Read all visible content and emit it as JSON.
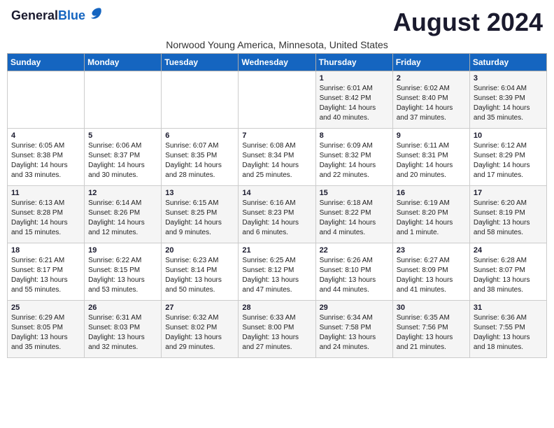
{
  "header": {
    "logo_general": "General",
    "logo_blue": "Blue",
    "month_title": "August 2024",
    "subtitle": "Norwood Young America, Minnesota, United States"
  },
  "days_of_week": [
    "Sunday",
    "Monday",
    "Tuesday",
    "Wednesday",
    "Thursday",
    "Friday",
    "Saturday"
  ],
  "weeks": [
    [
      {
        "day": "",
        "content": ""
      },
      {
        "day": "",
        "content": ""
      },
      {
        "day": "",
        "content": ""
      },
      {
        "day": "",
        "content": ""
      },
      {
        "day": "1",
        "content": "Sunrise: 6:01 AM\nSunset: 8:42 PM\nDaylight: 14 hours\nand 40 minutes."
      },
      {
        "day": "2",
        "content": "Sunrise: 6:02 AM\nSunset: 8:40 PM\nDaylight: 14 hours\nand 37 minutes."
      },
      {
        "day": "3",
        "content": "Sunrise: 6:04 AM\nSunset: 8:39 PM\nDaylight: 14 hours\nand 35 minutes."
      }
    ],
    [
      {
        "day": "4",
        "content": "Sunrise: 6:05 AM\nSunset: 8:38 PM\nDaylight: 14 hours\nand 33 minutes."
      },
      {
        "day": "5",
        "content": "Sunrise: 6:06 AM\nSunset: 8:37 PM\nDaylight: 14 hours\nand 30 minutes."
      },
      {
        "day": "6",
        "content": "Sunrise: 6:07 AM\nSunset: 8:35 PM\nDaylight: 14 hours\nand 28 minutes."
      },
      {
        "day": "7",
        "content": "Sunrise: 6:08 AM\nSunset: 8:34 PM\nDaylight: 14 hours\nand 25 minutes."
      },
      {
        "day": "8",
        "content": "Sunrise: 6:09 AM\nSunset: 8:32 PM\nDaylight: 14 hours\nand 22 minutes."
      },
      {
        "day": "9",
        "content": "Sunrise: 6:11 AM\nSunset: 8:31 PM\nDaylight: 14 hours\nand 20 minutes."
      },
      {
        "day": "10",
        "content": "Sunrise: 6:12 AM\nSunset: 8:29 PM\nDaylight: 14 hours\nand 17 minutes."
      }
    ],
    [
      {
        "day": "11",
        "content": "Sunrise: 6:13 AM\nSunset: 8:28 PM\nDaylight: 14 hours\nand 15 minutes."
      },
      {
        "day": "12",
        "content": "Sunrise: 6:14 AM\nSunset: 8:26 PM\nDaylight: 14 hours\nand 12 minutes."
      },
      {
        "day": "13",
        "content": "Sunrise: 6:15 AM\nSunset: 8:25 PM\nDaylight: 14 hours\nand 9 minutes."
      },
      {
        "day": "14",
        "content": "Sunrise: 6:16 AM\nSunset: 8:23 PM\nDaylight: 14 hours\nand 6 minutes."
      },
      {
        "day": "15",
        "content": "Sunrise: 6:18 AM\nSunset: 8:22 PM\nDaylight: 14 hours\nand 4 minutes."
      },
      {
        "day": "16",
        "content": "Sunrise: 6:19 AM\nSunset: 8:20 PM\nDaylight: 14 hours\nand 1 minute."
      },
      {
        "day": "17",
        "content": "Sunrise: 6:20 AM\nSunset: 8:19 PM\nDaylight: 13 hours\nand 58 minutes."
      }
    ],
    [
      {
        "day": "18",
        "content": "Sunrise: 6:21 AM\nSunset: 8:17 PM\nDaylight: 13 hours\nand 55 minutes."
      },
      {
        "day": "19",
        "content": "Sunrise: 6:22 AM\nSunset: 8:15 PM\nDaylight: 13 hours\nand 53 minutes."
      },
      {
        "day": "20",
        "content": "Sunrise: 6:23 AM\nSunset: 8:14 PM\nDaylight: 13 hours\nand 50 minutes."
      },
      {
        "day": "21",
        "content": "Sunrise: 6:25 AM\nSunset: 8:12 PM\nDaylight: 13 hours\nand 47 minutes."
      },
      {
        "day": "22",
        "content": "Sunrise: 6:26 AM\nSunset: 8:10 PM\nDaylight: 13 hours\nand 44 minutes."
      },
      {
        "day": "23",
        "content": "Sunrise: 6:27 AM\nSunset: 8:09 PM\nDaylight: 13 hours\nand 41 minutes."
      },
      {
        "day": "24",
        "content": "Sunrise: 6:28 AM\nSunset: 8:07 PM\nDaylight: 13 hours\nand 38 minutes."
      }
    ],
    [
      {
        "day": "25",
        "content": "Sunrise: 6:29 AM\nSunset: 8:05 PM\nDaylight: 13 hours\nand 35 minutes."
      },
      {
        "day": "26",
        "content": "Sunrise: 6:31 AM\nSunset: 8:03 PM\nDaylight: 13 hours\nand 32 minutes."
      },
      {
        "day": "27",
        "content": "Sunrise: 6:32 AM\nSunset: 8:02 PM\nDaylight: 13 hours\nand 29 minutes."
      },
      {
        "day": "28",
        "content": "Sunrise: 6:33 AM\nSunset: 8:00 PM\nDaylight: 13 hours\nand 27 minutes."
      },
      {
        "day": "29",
        "content": "Sunrise: 6:34 AM\nSunset: 7:58 PM\nDaylight: 13 hours\nand 24 minutes."
      },
      {
        "day": "30",
        "content": "Sunrise: 6:35 AM\nSunset: 7:56 PM\nDaylight: 13 hours\nand 21 minutes."
      },
      {
        "day": "31",
        "content": "Sunrise: 6:36 AM\nSunset: 7:55 PM\nDaylight: 13 hours\nand 18 minutes."
      }
    ]
  ]
}
